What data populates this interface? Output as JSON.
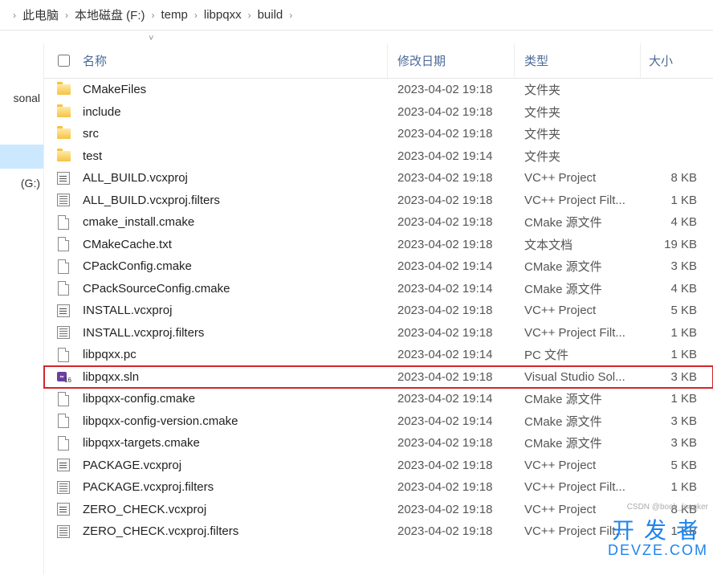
{
  "breadcrumb": [
    "此电脑",
    "本地磁盘 (F:)",
    "temp",
    "libpqxx",
    "build"
  ],
  "columns": {
    "name": "名称",
    "date": "修改日期",
    "type": "类型",
    "size": "大小"
  },
  "sidebar": {
    "items": [
      {
        "label": "sonal"
      },
      {
        "label": ""
      },
      {
        "label": "",
        "selected": true
      },
      {
        "label": "(G:)"
      }
    ]
  },
  "folder_type": "文件夹",
  "files": [
    {
      "icon": "folder",
      "name": "CMakeFiles",
      "date": "2023-04-02 19:18",
      "type": "文件夹",
      "size": ""
    },
    {
      "icon": "folder",
      "name": "include",
      "date": "2023-04-02 19:18",
      "type": "文件夹",
      "size": ""
    },
    {
      "icon": "folder",
      "name": "src",
      "date": "2023-04-02 19:18",
      "type": "文件夹",
      "size": ""
    },
    {
      "icon": "folder",
      "name": "test",
      "date": "2023-04-02 19:14",
      "type": "文件夹",
      "size": ""
    },
    {
      "icon": "vcx",
      "name": "ALL_BUILD.vcxproj",
      "date": "2023-04-02 19:18",
      "type": "VC++ Project",
      "size": "8 KB"
    },
    {
      "icon": "flt",
      "name": "ALL_BUILD.vcxproj.filters",
      "date": "2023-04-02 19:18",
      "type": "VC++ Project Filt...",
      "size": "1 KB"
    },
    {
      "icon": "file",
      "name": "cmake_install.cmake",
      "date": "2023-04-02 19:18",
      "type": "CMake 源文件",
      "size": "4 KB"
    },
    {
      "icon": "file",
      "name": "CMakeCache.txt",
      "date": "2023-04-02 19:18",
      "type": "文本文档",
      "size": "19 KB"
    },
    {
      "icon": "file",
      "name": "CPackConfig.cmake",
      "date": "2023-04-02 19:14",
      "type": "CMake 源文件",
      "size": "3 KB"
    },
    {
      "icon": "file",
      "name": "CPackSourceConfig.cmake",
      "date": "2023-04-02 19:14",
      "type": "CMake 源文件",
      "size": "4 KB"
    },
    {
      "icon": "vcx",
      "name": "INSTALL.vcxproj",
      "date": "2023-04-02 19:18",
      "type": "VC++ Project",
      "size": "5 KB"
    },
    {
      "icon": "flt",
      "name": "INSTALL.vcxproj.filters",
      "date": "2023-04-02 19:18",
      "type": "VC++ Project Filt...",
      "size": "1 KB"
    },
    {
      "icon": "file",
      "name": "libpqxx.pc",
      "date": "2023-04-02 19:14",
      "type": "PC 文件",
      "size": "1 KB"
    },
    {
      "icon": "sln",
      "name": "libpqxx.sln",
      "date": "2023-04-02 19:18",
      "type": "Visual Studio Sol...",
      "size": "3 KB",
      "highlight": true
    },
    {
      "icon": "file",
      "name": "libpqxx-config.cmake",
      "date": "2023-04-02 19:14",
      "type": "CMake 源文件",
      "size": "1 KB"
    },
    {
      "icon": "file",
      "name": "libpqxx-config-version.cmake",
      "date": "2023-04-02 19:14",
      "type": "CMake 源文件",
      "size": "3 KB"
    },
    {
      "icon": "file",
      "name": "libpqxx-targets.cmake",
      "date": "2023-04-02 19:18",
      "type": "CMake 源文件",
      "size": "3 KB"
    },
    {
      "icon": "vcx",
      "name": "PACKAGE.vcxproj",
      "date": "2023-04-02 19:18",
      "type": "VC++ Project",
      "size": "5 KB"
    },
    {
      "icon": "flt",
      "name": "PACKAGE.vcxproj.filters",
      "date": "2023-04-02 19:18",
      "type": "VC++ Project Filt...",
      "size": "1 KB"
    },
    {
      "icon": "vcx",
      "name": "ZERO_CHECK.vcxproj",
      "date": "2023-04-02 19:18",
      "type": "VC++ Project",
      "size": "8 KB"
    },
    {
      "icon": "flt",
      "name": "ZERO_CHECK.vcxproj.filters",
      "date": "2023-04-02 19:18",
      "type": "VC++ Project Filt...",
      "size": "1 KB"
    }
  ],
  "watermark": {
    "zh": "开发者",
    "en": "DEVZE.COM",
    "small": "CSDN @book_longker"
  }
}
